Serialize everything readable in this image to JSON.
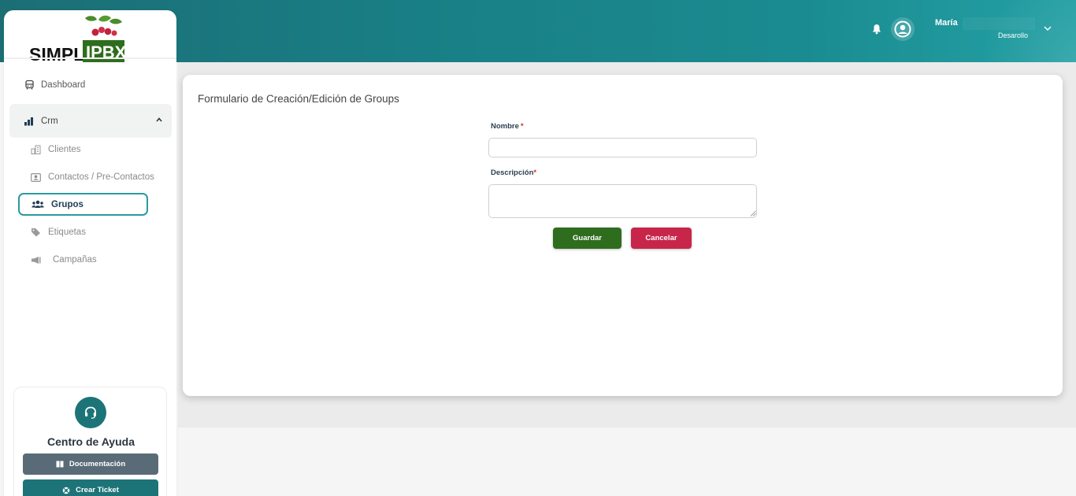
{
  "header": {
    "user_name": "María",
    "user_role": "Desarollo"
  },
  "logo": {
    "text_simple": "SIMPLE",
    "text_ipbx": "IPBX"
  },
  "sidebar": {
    "dashboard_label": "Dashboard",
    "crm_label": "Crm",
    "crm_items": [
      {
        "label": "Clientes",
        "icon": "buildings-icon"
      },
      {
        "label": "Contactos / Pre-Contactos",
        "icon": "contact-card-icon"
      },
      {
        "label": "Grupos",
        "icon": "users-icon",
        "active": true
      },
      {
        "label": "Etiquetas",
        "icon": "tag-icon"
      },
      {
        "label": "Campañas",
        "icon": "megaphone-icon"
      }
    ]
  },
  "help": {
    "title": "Centro de Ayuda",
    "docs_label": "Documentación",
    "ticket_label": "Crear Ticket"
  },
  "form": {
    "title": "Formulario de Creación/Edición de Groups",
    "name_label": "Nombre",
    "name_required": "*",
    "name_value": "",
    "desc_label": "Descripción",
    "desc_required": "*",
    "desc_value": "",
    "save_label": "Guardar",
    "cancel_label": "Cancelar"
  },
  "colors": {
    "header_teal": "#197f86",
    "save_green": "#2e6d1e",
    "cancel_red": "#c7264a",
    "active_border": "#2a9aa0",
    "help_teal": "#1d7478"
  }
}
